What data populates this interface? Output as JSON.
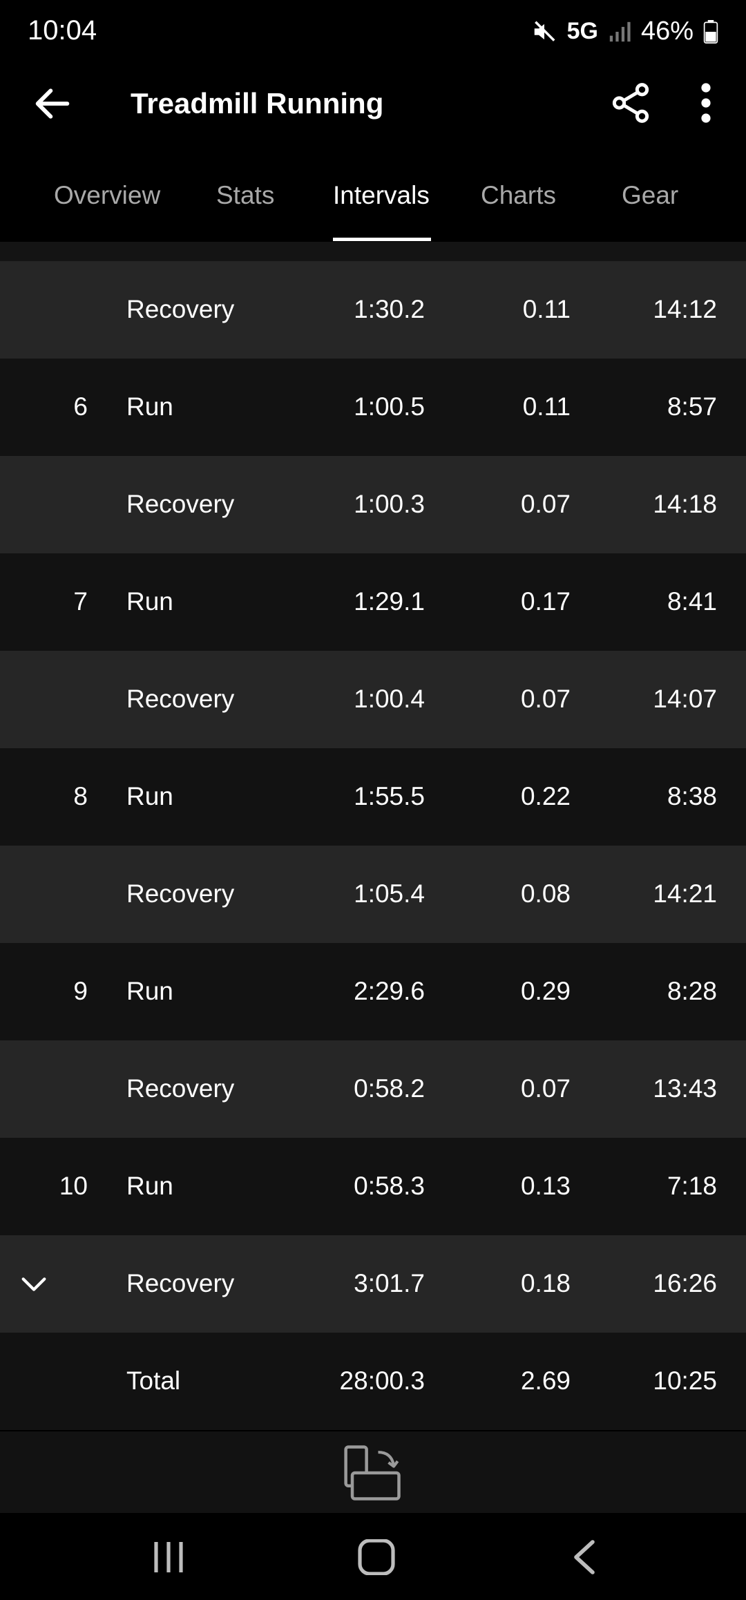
{
  "status": {
    "time": "10:04",
    "network": "5G",
    "battery": "46%"
  },
  "header": {
    "title": "Treadmill Running"
  },
  "tabs": [
    {
      "label": "Overview"
    },
    {
      "label": "Stats"
    },
    {
      "label": "Intervals"
    },
    {
      "label": "Charts"
    },
    {
      "label": "Gear"
    }
  ],
  "intervals": [
    {
      "num": "",
      "type": "Recovery",
      "time": "1:30.2",
      "dist": "0.11",
      "pace": "14:12"
    },
    {
      "num": "6",
      "type": "Run",
      "time": "1:00.5",
      "dist": "0.11",
      "pace": "8:57"
    },
    {
      "num": "",
      "type": "Recovery",
      "time": "1:00.3",
      "dist": "0.07",
      "pace": "14:18"
    },
    {
      "num": "7",
      "type": "Run",
      "time": "1:29.1",
      "dist": "0.17",
      "pace": "8:41"
    },
    {
      "num": "",
      "type": "Recovery",
      "time": "1:00.4",
      "dist": "0.07",
      "pace": "14:07"
    },
    {
      "num": "8",
      "type": "Run",
      "time": "1:55.5",
      "dist": "0.22",
      "pace": "8:38"
    },
    {
      "num": "",
      "type": "Recovery",
      "time": "1:05.4",
      "dist": "0.08",
      "pace": "14:21"
    },
    {
      "num": "9",
      "type": "Run",
      "time": "2:29.6",
      "dist": "0.29",
      "pace": "8:28"
    },
    {
      "num": "",
      "type": "Recovery",
      "time": "0:58.2",
      "dist": "0.07",
      "pace": "13:43"
    },
    {
      "num": "10",
      "type": "Run",
      "time": "0:58.3",
      "dist": "0.13",
      "pace": "7:18"
    },
    {
      "num": "",
      "type": "Recovery",
      "time": "3:01.7",
      "dist": "0.18",
      "pace": "16:26"
    }
  ],
  "total": {
    "label": "Total",
    "time": "28:00.3",
    "dist": "2.69",
    "pace": "10:25"
  },
  "icons": {
    "back": "arrow-left-icon",
    "share": "share-icon",
    "more": "more-vertical-icon",
    "expand": "chevron-down-icon",
    "rotate": "rotate-screen-icon"
  },
  "colors": {
    "background": "#000000",
    "row_dark": "#121212",
    "row_light": "#262626",
    "tab_inactive": "#a9a9a9",
    "text": "#ffffff"
  }
}
